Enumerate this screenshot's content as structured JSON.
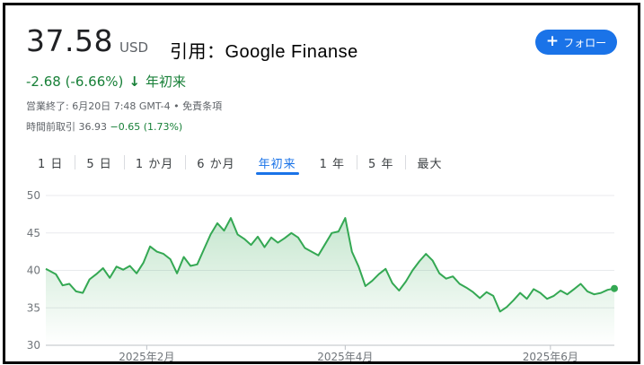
{
  "header": {
    "price": "37.58",
    "currency": "USD",
    "quote": "引用：Google Finanse",
    "follow_label": "フォロー",
    "change": "-2.68 (-6.66%)",
    "period": "年初来",
    "meta": "営業終了: 6月20日 7:48 GMT-4 • 免責条項",
    "ext_prefix": "時間前取引 36.93 ",
    "ext_change": "−0.65 (1.73%)"
  },
  "tabs": [
    "1 日",
    "5 日",
    "1 か月",
    "6 か月",
    "年初来",
    "1 年",
    "5 年",
    "最大"
  ],
  "active_tab": 4,
  "colors": {
    "line": "#34a853",
    "accent": "#1a73e8",
    "text_positive": "#188038"
  },
  "chart_data": {
    "type": "area",
    "title": "",
    "xlabel": "",
    "ylabel": "",
    "ylim": [
      30,
      50
    ],
    "yticks": [
      30,
      35,
      40,
      45,
      50
    ],
    "xtick_labels": [
      {
        "label": "2025年2月",
        "date": "2025-02-01"
      },
      {
        "label": "2025年4月",
        "date": "2025-04-01"
      },
      {
        "label": "2025年6月",
        "date": "2025-06-01"
      }
    ],
    "x_range": [
      "2025-01-02",
      "2025-06-20"
    ],
    "grid": true,
    "series": [
      {
        "x": [
          "2025-01-02",
          "2025-01-05",
          "2025-01-07",
          "2025-01-09",
          "2025-01-11",
          "2025-01-13",
          "2025-01-15",
          "2025-01-17",
          "2025-01-19",
          "2025-01-21",
          "2025-01-23",
          "2025-01-25",
          "2025-01-27",
          "2025-01-29",
          "2025-01-31",
          "2025-02-02",
          "2025-02-04",
          "2025-02-06",
          "2025-02-08",
          "2025-02-10",
          "2025-02-12",
          "2025-02-14",
          "2025-02-16",
          "2025-02-18",
          "2025-02-20",
          "2025-02-22",
          "2025-02-24",
          "2025-02-26",
          "2025-02-28",
          "2025-03-02",
          "2025-03-04",
          "2025-03-06",
          "2025-03-08",
          "2025-03-10",
          "2025-03-12",
          "2025-03-14",
          "2025-03-16",
          "2025-03-18",
          "2025-03-20",
          "2025-03-22",
          "2025-03-24",
          "2025-03-26",
          "2025-03-28",
          "2025-03-30",
          "2025-04-01",
          "2025-04-03",
          "2025-04-05",
          "2025-04-07",
          "2025-04-09",
          "2025-04-11",
          "2025-04-13",
          "2025-04-15",
          "2025-04-17",
          "2025-04-19",
          "2025-04-21",
          "2025-04-23",
          "2025-04-25",
          "2025-04-27",
          "2025-04-29",
          "2025-05-01",
          "2025-05-03",
          "2025-05-05",
          "2025-05-07",
          "2025-05-09",
          "2025-05-11",
          "2025-05-13",
          "2025-05-15",
          "2025-05-17",
          "2025-05-19",
          "2025-05-21",
          "2025-05-23",
          "2025-05-25",
          "2025-05-27",
          "2025-05-29",
          "2025-05-31",
          "2025-06-02",
          "2025-06-04",
          "2025-06-06",
          "2025-06-08",
          "2025-06-10",
          "2025-06-12",
          "2025-06-14",
          "2025-06-16",
          "2025-06-18",
          "2025-06-20"
        ],
        "y": [
          40.2,
          39.5,
          38.0,
          38.2,
          37.2,
          37.0,
          38.8,
          39.5,
          40.3,
          39.0,
          40.5,
          40.1,
          40.6,
          39.6,
          41.0,
          43.2,
          42.5,
          42.2,
          41.5,
          39.6,
          41.8,
          40.6,
          40.8,
          42.8,
          44.8,
          46.3,
          45.3,
          47.0,
          44.8,
          44.2,
          43.4,
          44.5,
          43.1,
          44.4,
          43.7,
          44.3,
          45.0,
          44.4,
          43.0,
          42.5,
          42.0,
          43.5,
          45.0,
          45.2,
          47.0,
          42.5,
          40.5,
          37.9,
          38.6,
          39.5,
          40.2,
          38.3,
          37.3,
          38.5,
          40.0,
          41.2,
          42.2,
          41.3,
          39.6,
          38.9,
          39.2,
          38.2,
          37.7,
          37.1,
          36.3,
          37.1,
          36.6,
          34.5,
          35.1,
          36.0,
          37.0,
          36.2,
          37.5,
          37.0,
          36.2,
          36.6,
          37.3,
          36.8,
          37.5,
          38.2,
          37.2,
          36.8,
          37.0,
          37.4,
          37.58
        ]
      }
    ]
  }
}
